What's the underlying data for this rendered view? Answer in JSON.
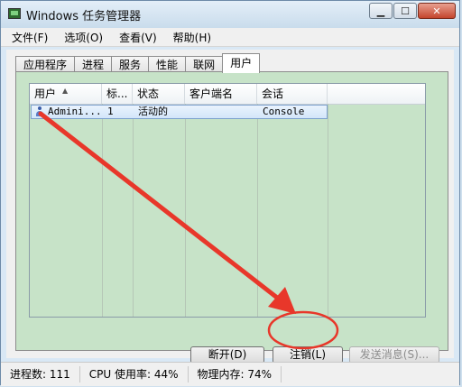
{
  "window": {
    "title": "Windows 任务管理器"
  },
  "menu": [
    "文件(F)",
    "选项(O)",
    "查看(V)",
    "帮助(H)"
  ],
  "tabs": [
    {
      "label": "应用程序",
      "active": false
    },
    {
      "label": "进程",
      "active": false
    },
    {
      "label": "服务",
      "active": false
    },
    {
      "label": "性能",
      "active": false
    },
    {
      "label": "联网",
      "active": false
    },
    {
      "label": "用户",
      "active": true
    }
  ],
  "table": {
    "columns": [
      "用户",
      "标...",
      "状态",
      "客户端名",
      "会话"
    ],
    "rows": [
      {
        "user": "Admini...",
        "id": "1",
        "status": "活动的",
        "client": "",
        "session": "Console"
      }
    ]
  },
  "buttons": {
    "disconnect": "断开(D)",
    "logoff": "注销(L)",
    "send_message": "发送消息(S)..."
  },
  "status": {
    "processes": "进程数: 111",
    "cpu": "CPU 使用率: 44%",
    "memory": "物理内存: 74%"
  },
  "colors": {
    "annotation": "#e8372a",
    "panel_bg": "#c7e3c8"
  }
}
